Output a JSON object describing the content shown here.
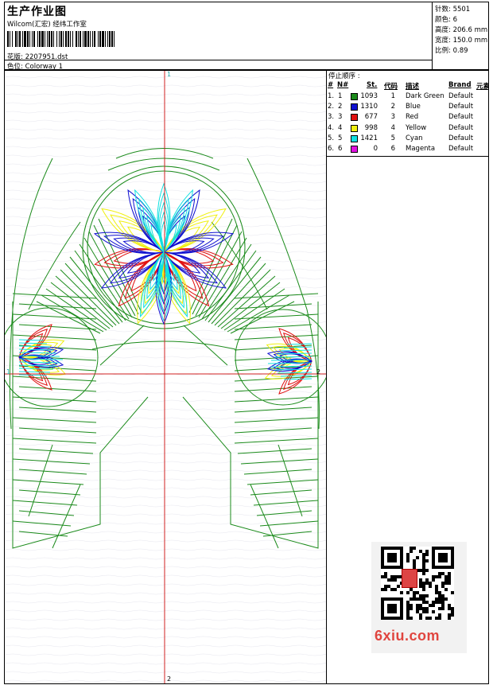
{
  "header": {
    "title": "生产作业图",
    "company": "Wilcom(汇宏) 经纬工作室",
    "file_label": "花版: 2207951.dst",
    "colorway_label": "色位: Colorway 1"
  },
  "stats": [
    {
      "label": "针数:",
      "value": "5501"
    },
    {
      "label": "颜色:",
      "value": "6"
    },
    {
      "label": "高度:",
      "value": "206.6 mm"
    },
    {
      "label": "宽度:",
      "value": "150.0 mm"
    },
    {
      "label": "比例:",
      "value": "0.89"
    }
  ],
  "stop_sequence": {
    "title": "停止顺序 :",
    "headers": {
      "hash": "#",
      "n": "N#",
      "st": "St.",
      "code": "代码",
      "desc": "描述",
      "brand": "Brand",
      "elem": "元素"
    },
    "rows": [
      {
        "idx": "1.",
        "n": "1",
        "color": "#1a8a1a",
        "st": "1093",
        "code": "1",
        "desc": "Dark Green",
        "brand": "Default"
      },
      {
        "idx": "2.",
        "n": "2",
        "color": "#1010d0",
        "st": "1310",
        "code": "2",
        "desc": "Blue",
        "brand": "Default"
      },
      {
        "idx": "3.",
        "n": "3",
        "color": "#e01010",
        "st": "677",
        "code": "3",
        "desc": "Red",
        "brand": "Default"
      },
      {
        "idx": "4.",
        "n": "4",
        "color": "#f0f010",
        "st": "998",
        "code": "4",
        "desc": "Yellow",
        "brand": "Default"
      },
      {
        "idx": "5.",
        "n": "5",
        "color": "#10e0e0",
        "st": "1421",
        "code": "5",
        "desc": "Cyan",
        "brand": "Default"
      },
      {
        "idx": "6.",
        "n": "6",
        "color": "#e010e0",
        "st": "0",
        "code": "6",
        "desc": "Magenta",
        "brand": "Default"
      }
    ]
  },
  "axes": {
    "top": "1",
    "left": "1",
    "right": "2",
    "bottom": "2"
  },
  "watermark": {
    "text": "6xiu.com"
  },
  "colors": {
    "green": "#1a8a1a",
    "blue": "#1010d0",
    "red": "#e01010",
    "yellow": "#f0f010",
    "cyan": "#10e0e0",
    "axis": "#d02020"
  }
}
